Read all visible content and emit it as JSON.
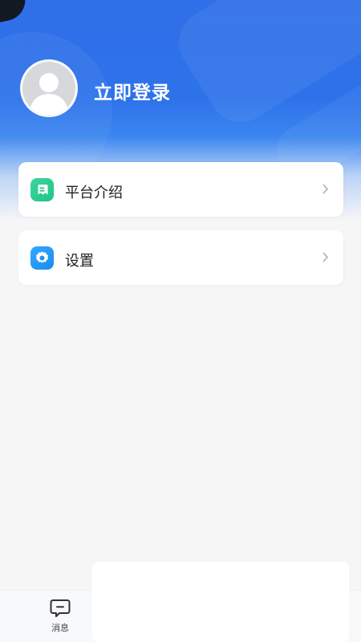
{
  "profile": {
    "login_label": "立即登录"
  },
  "menu": {
    "items": [
      {
        "label": "平台介绍",
        "icon": "document-icon",
        "icon_color": "#20c387"
      },
      {
        "label": "设置",
        "icon": "gear-icon",
        "icon_color": "#1b8cf2"
      }
    ]
  },
  "tabbar": {
    "items": [
      {
        "label": "消息",
        "icon": "message-icon"
      }
    ]
  },
  "theme": {
    "header_blue": "#2f6fe8",
    "background": "#f6f6f7"
  }
}
